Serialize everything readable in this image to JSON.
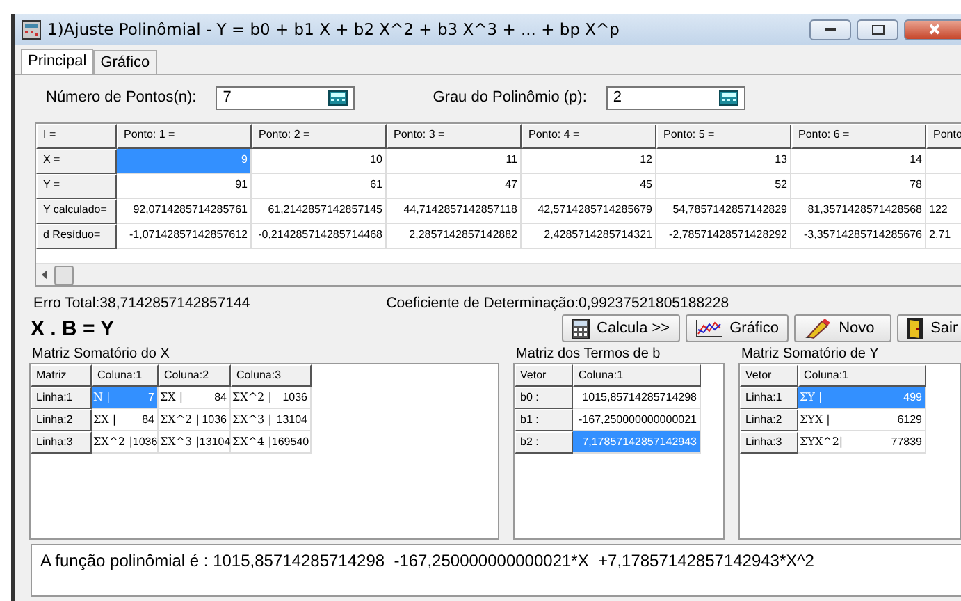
{
  "window": {
    "title": "1)Ajuste Polinômial - Y = b0 + b1 X + b2 X^2 + b3 X^3 + ... + bp X^p"
  },
  "tabs": [
    {
      "label": "Principal",
      "selected": true
    },
    {
      "label": "Gráfico",
      "selected": false
    }
  ],
  "fields": [
    {
      "label": "Número de Pontos(n):",
      "value": "7"
    },
    {
      "label": "Grau do Polinômio (p):",
      "value": "2"
    }
  ],
  "grid": {
    "corner": "I =",
    "columns": [
      "Ponto: 1 =",
      "Ponto: 2 =",
      "Ponto: 3 =",
      "Ponto: 4 =",
      "Ponto: 5 =",
      "Ponto: 6 =",
      "Ponto"
    ],
    "rows": [
      {
        "label": "X =",
        "cells": [
          {
            "text": "9",
            "selected": true
          },
          {
            "text": "10",
            "selected": false
          },
          {
            "text": "11",
            "selected": false
          },
          {
            "text": "12",
            "selected": false
          },
          {
            "text": "13",
            "selected": false
          },
          {
            "text": "14",
            "selected": false
          }
        ]
      },
      {
        "label": "Y =",
        "cells": [
          {
            "text": "91",
            "selected": false
          },
          {
            "text": "61",
            "selected": false
          },
          {
            "text": "47",
            "selected": false
          },
          {
            "text": "45",
            "selected": false
          },
          {
            "text": "52",
            "selected": false
          },
          {
            "text": "78",
            "selected": false
          }
        ]
      },
      {
        "label": "Y calculado=",
        "cells": [
          {
            "text": "92,0714285714285761",
            "selected": false
          },
          {
            "text": "61,2142857142857145",
            "selected": false
          },
          {
            "text": "44,7142857142857118",
            "selected": false
          },
          {
            "text": "42,5714285714285679",
            "selected": false
          },
          {
            "text": "54,7857142857142829",
            "selected": false
          },
          {
            "text": "81,3571428571428568",
            "selected": false
          },
          {
            "text": "122",
            "selected": false
          }
        ]
      },
      {
        "label": "d Resíduo=",
        "cells": [
          {
            "text": "-1,07142857142857612",
            "selected": false
          },
          {
            "text": "-0,214285714285714468",
            "selected": false
          },
          {
            "text": "2,2857142857142882",
            "selected": false
          },
          {
            "text": "2,4285714285714321",
            "selected": false
          },
          {
            "text": "-2,78571428571428292",
            "selected": false
          },
          {
            "text": "-3,35714285714285676",
            "selected": false
          },
          {
            "text": "2,71",
            "selected": false
          }
        ]
      }
    ]
  },
  "stats": {
    "error": "Erro Total:38,7142857142857144",
    "determination": "Coeficiente de Determinação:0,99237521805188228"
  },
  "equation": "X . B = Y",
  "buttons": [
    {
      "label": "Calcula >>",
      "kind": "calculator"
    },
    {
      "label": "Gráfico",
      "kind": "chart"
    },
    {
      "label": "Novo",
      "kind": "pen"
    },
    {
      "label": "Sair",
      "kind": "door"
    }
  ],
  "matrices": [
    {
      "title": "Matriz Somatório do X",
      "corner": "Matriz",
      "columns": [
        "Coluna:1",
        "Coluna:2",
        "Coluna:3"
      ],
      "rows": [
        {
          "label": "Linha:1",
          "cells": [
            {
              "symbol": "N |",
              "value": "7",
              "selected": true
            },
            {
              "symbol": "ΣX |",
              "value": "84",
              "selected": false
            },
            {
              "symbol": "ΣX^2 |",
              "value": "1036",
              "selected": false
            }
          ]
        },
        {
          "label": "Linha:2",
          "cells": [
            {
              "symbol": "ΣX |",
              "value": "84",
              "selected": false
            },
            {
              "symbol": "ΣX^2 |",
              "value": "1036",
              "selected": false
            },
            {
              "symbol": "ΣX^3 |",
              "value": "13104",
              "selected": false
            }
          ]
        },
        {
          "label": "Linha:3",
          "cells": [
            {
              "symbol": "ΣX^2 |",
              "value": "1036",
              "selected": false
            },
            {
              "symbol": "ΣX^3 |",
              "value": "13104",
              "selected": false
            },
            {
              "symbol": "ΣX^4 |",
              "value": "169540",
              "selected": false
            }
          ]
        }
      ]
    },
    {
      "title": "Matriz dos Termos de b",
      "corner": "Vetor",
      "columns": [
        "Coluna:1"
      ],
      "rows": [
        {
          "label": "b0 :",
          "cells": [
            {
              "value": "1015,85714285714298",
              "selected": false
            }
          ]
        },
        {
          "label": "b1 :",
          "cells": [
            {
              "value": "-167,250000000000021",
              "selected": false
            }
          ]
        },
        {
          "label": "b2 :",
          "cells": [
            {
              "value": "7,17857142857142943",
              "selected": true
            }
          ]
        }
      ]
    },
    {
      "title": "Matriz Somatório de Y",
      "corner": "Vetor",
      "columns": [
        "Coluna:1"
      ],
      "rows": [
        {
          "label": "Linha:1",
          "cells": [
            {
              "symbol": "ΣY |",
              "value": "499",
              "selected": true
            }
          ]
        },
        {
          "label": "Linha:2",
          "cells": [
            {
              "symbol": "ΣYX |",
              "value": "6129",
              "selected": false
            }
          ]
        },
        {
          "label": "Linha:3",
          "cells": [
            {
              "symbol": "ΣYX^2|",
              "value": "77839",
              "selected": false
            }
          ]
        }
      ]
    }
  ],
  "result": "A função polinômial é : 1015,85714285714298  -167,250000000000021*X  +7,17857142857142943*X^2"
}
